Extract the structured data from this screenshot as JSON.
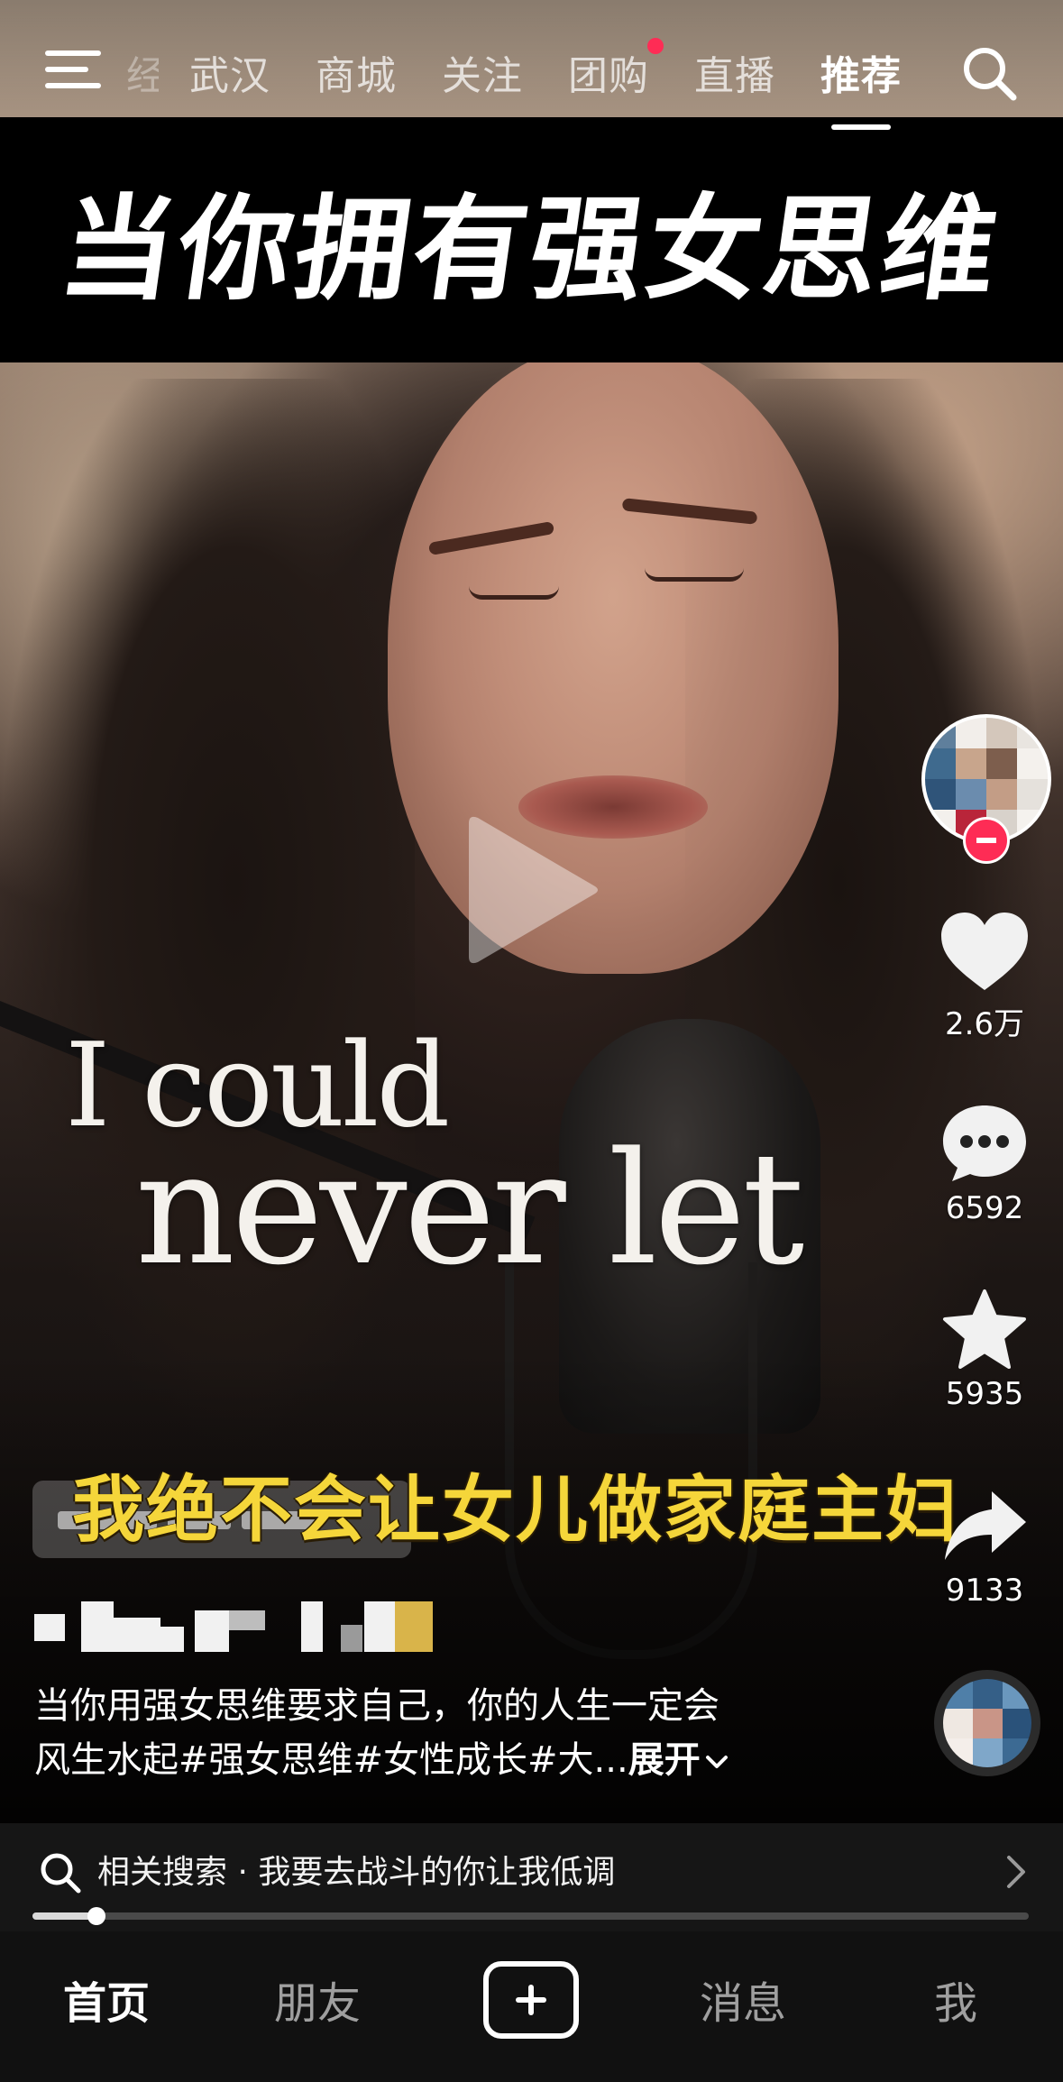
{
  "top_bar": {
    "partial_tab": "经验",
    "tabs": [
      {
        "label": "武汉",
        "active": false,
        "badge": false
      },
      {
        "label": "商城",
        "active": false,
        "badge": false
      },
      {
        "label": "关注",
        "active": false,
        "badge": false
      },
      {
        "label": "团购",
        "active": false,
        "badge": true
      },
      {
        "label": "直播",
        "active": false,
        "badge": false
      },
      {
        "label": "推荐",
        "active": true,
        "badge": false
      }
    ],
    "menu_icon": "hamburger-menu-icon",
    "search_icon": "search-icon"
  },
  "video": {
    "headline": "当你拥有强女思维",
    "subtitle_en_line1": "I could",
    "subtitle_en_line2": "never let",
    "subtitle_cn": "我绝不会让女儿做家庭主妇",
    "play_icon": "play-icon"
  },
  "post": {
    "caption_line1": "当你用强女思维要求自己，你的人生一定会",
    "caption_line2": "风生水起#强女思维#女性成长#大...",
    "expand_label": "展开",
    "expand_icon": "chevron-down-icon"
  },
  "actions": {
    "likes": "2.6万",
    "comments": "6592",
    "favorites": "5935",
    "shares": "9133"
  },
  "related_search": {
    "prefix": "相关搜索",
    "separator": "·",
    "query": "我要去战斗的你让我低调"
  },
  "progress": {
    "fraction": 0.064
  },
  "bottom_nav": {
    "home": "首页",
    "friends": "朋友",
    "messages": "消息",
    "me": "我"
  },
  "colors": {
    "accent": "#fe2c55",
    "subtitle_yellow": "#f5d63a",
    "nav_background": "#111111",
    "related_background": "#161616"
  }
}
